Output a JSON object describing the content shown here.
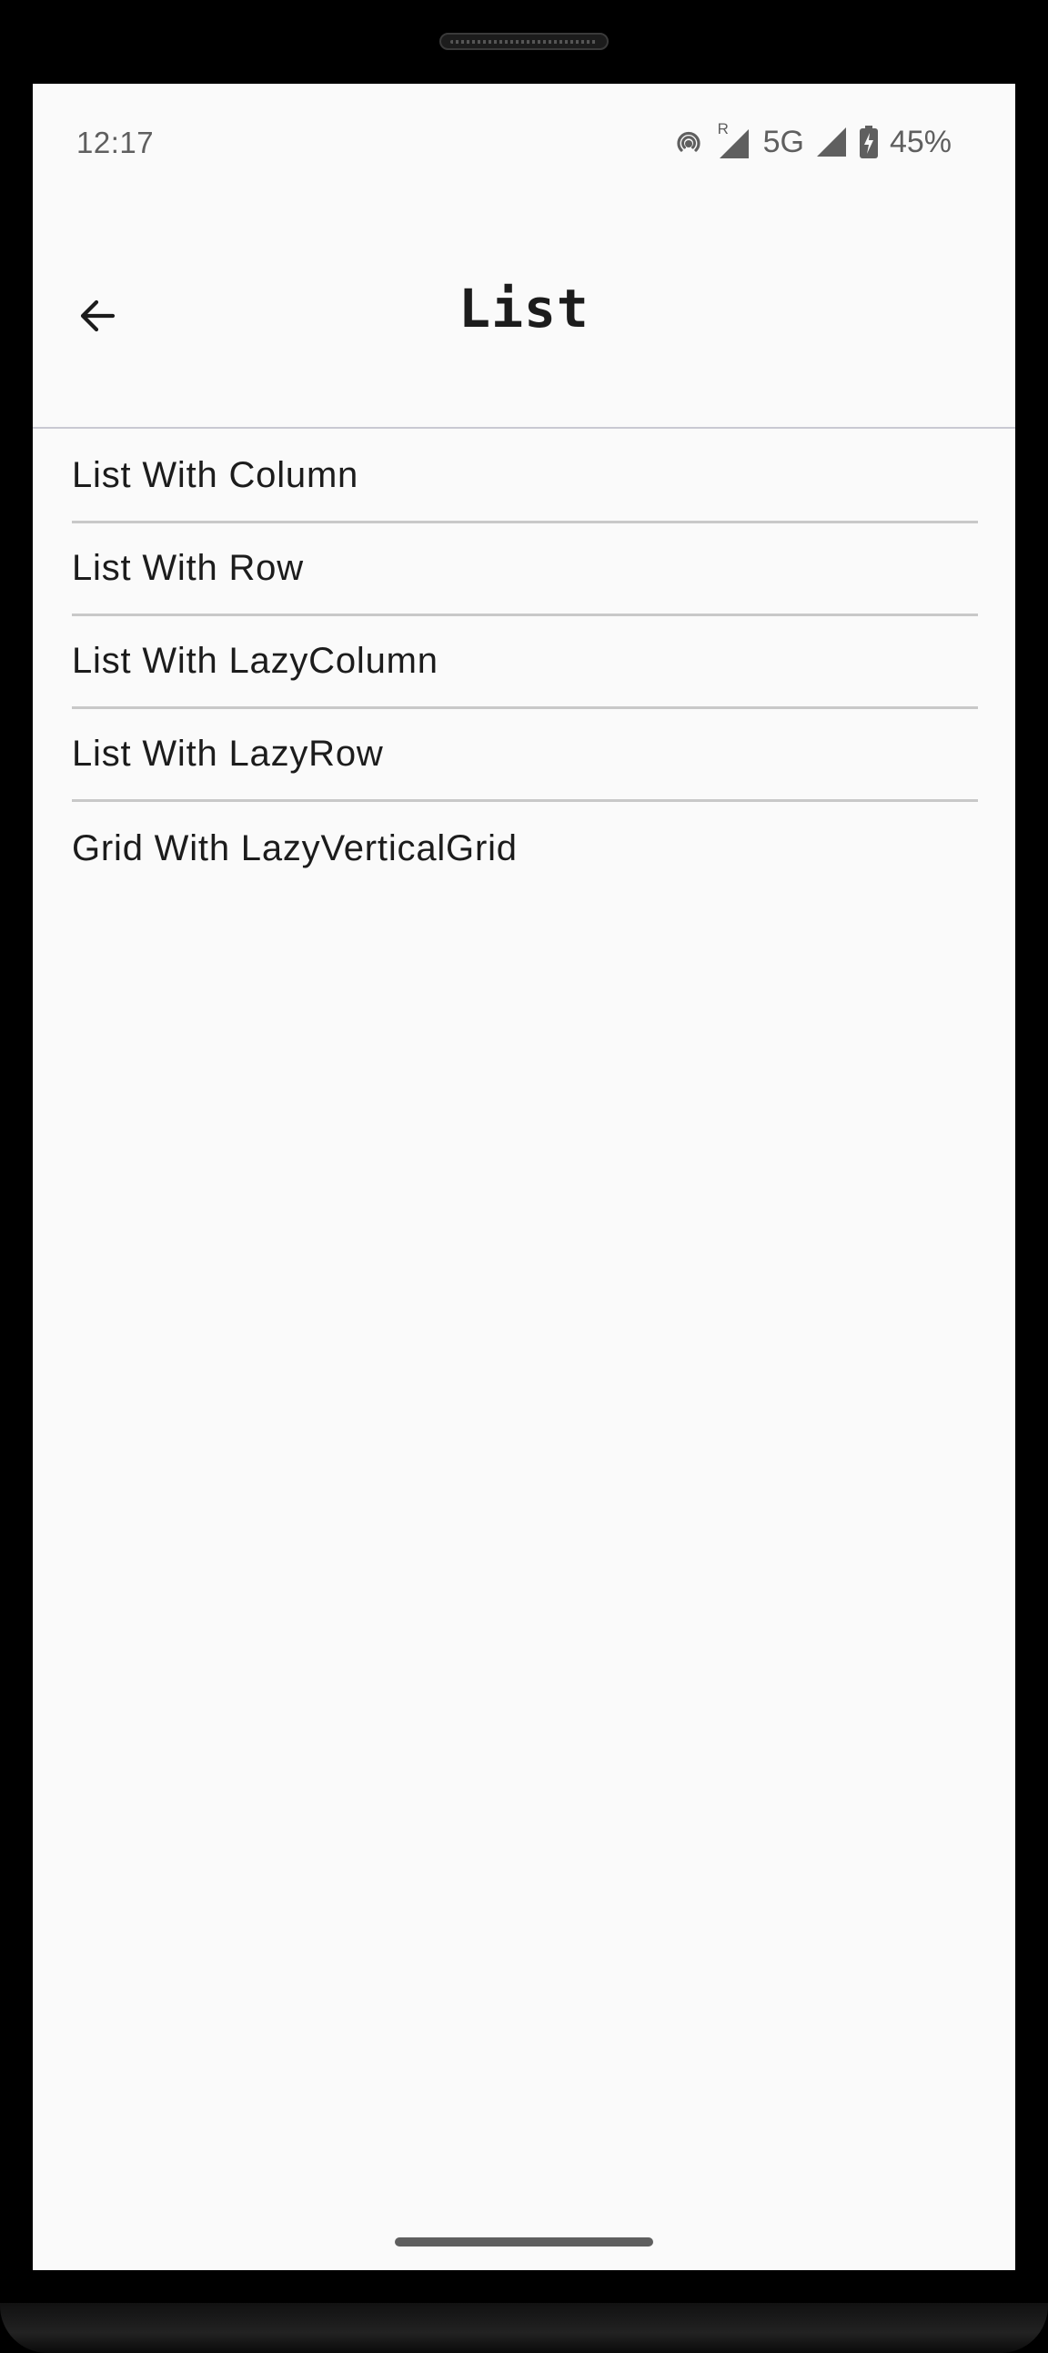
{
  "status_bar": {
    "time": "12:17",
    "roaming_indicator": "R",
    "network_type": "5G",
    "battery": "45%",
    "icons": [
      "hotspot-icon",
      "signal-roaming-icon",
      "signal-icon",
      "battery-charging-icon"
    ]
  },
  "app_bar": {
    "title": "List",
    "back_icon": "arrow-back-icon"
  },
  "list": {
    "items": [
      "List With Column",
      "List With Row",
      "List With LazyColumn",
      "List With LazyRow",
      "Grid With LazyVerticalGrid"
    ]
  },
  "colors": {
    "background": "#fafafa",
    "text": "#1c1c1c",
    "status_text": "#5f5f5f",
    "divider": "#c8c8c8",
    "frame": "#000000"
  }
}
